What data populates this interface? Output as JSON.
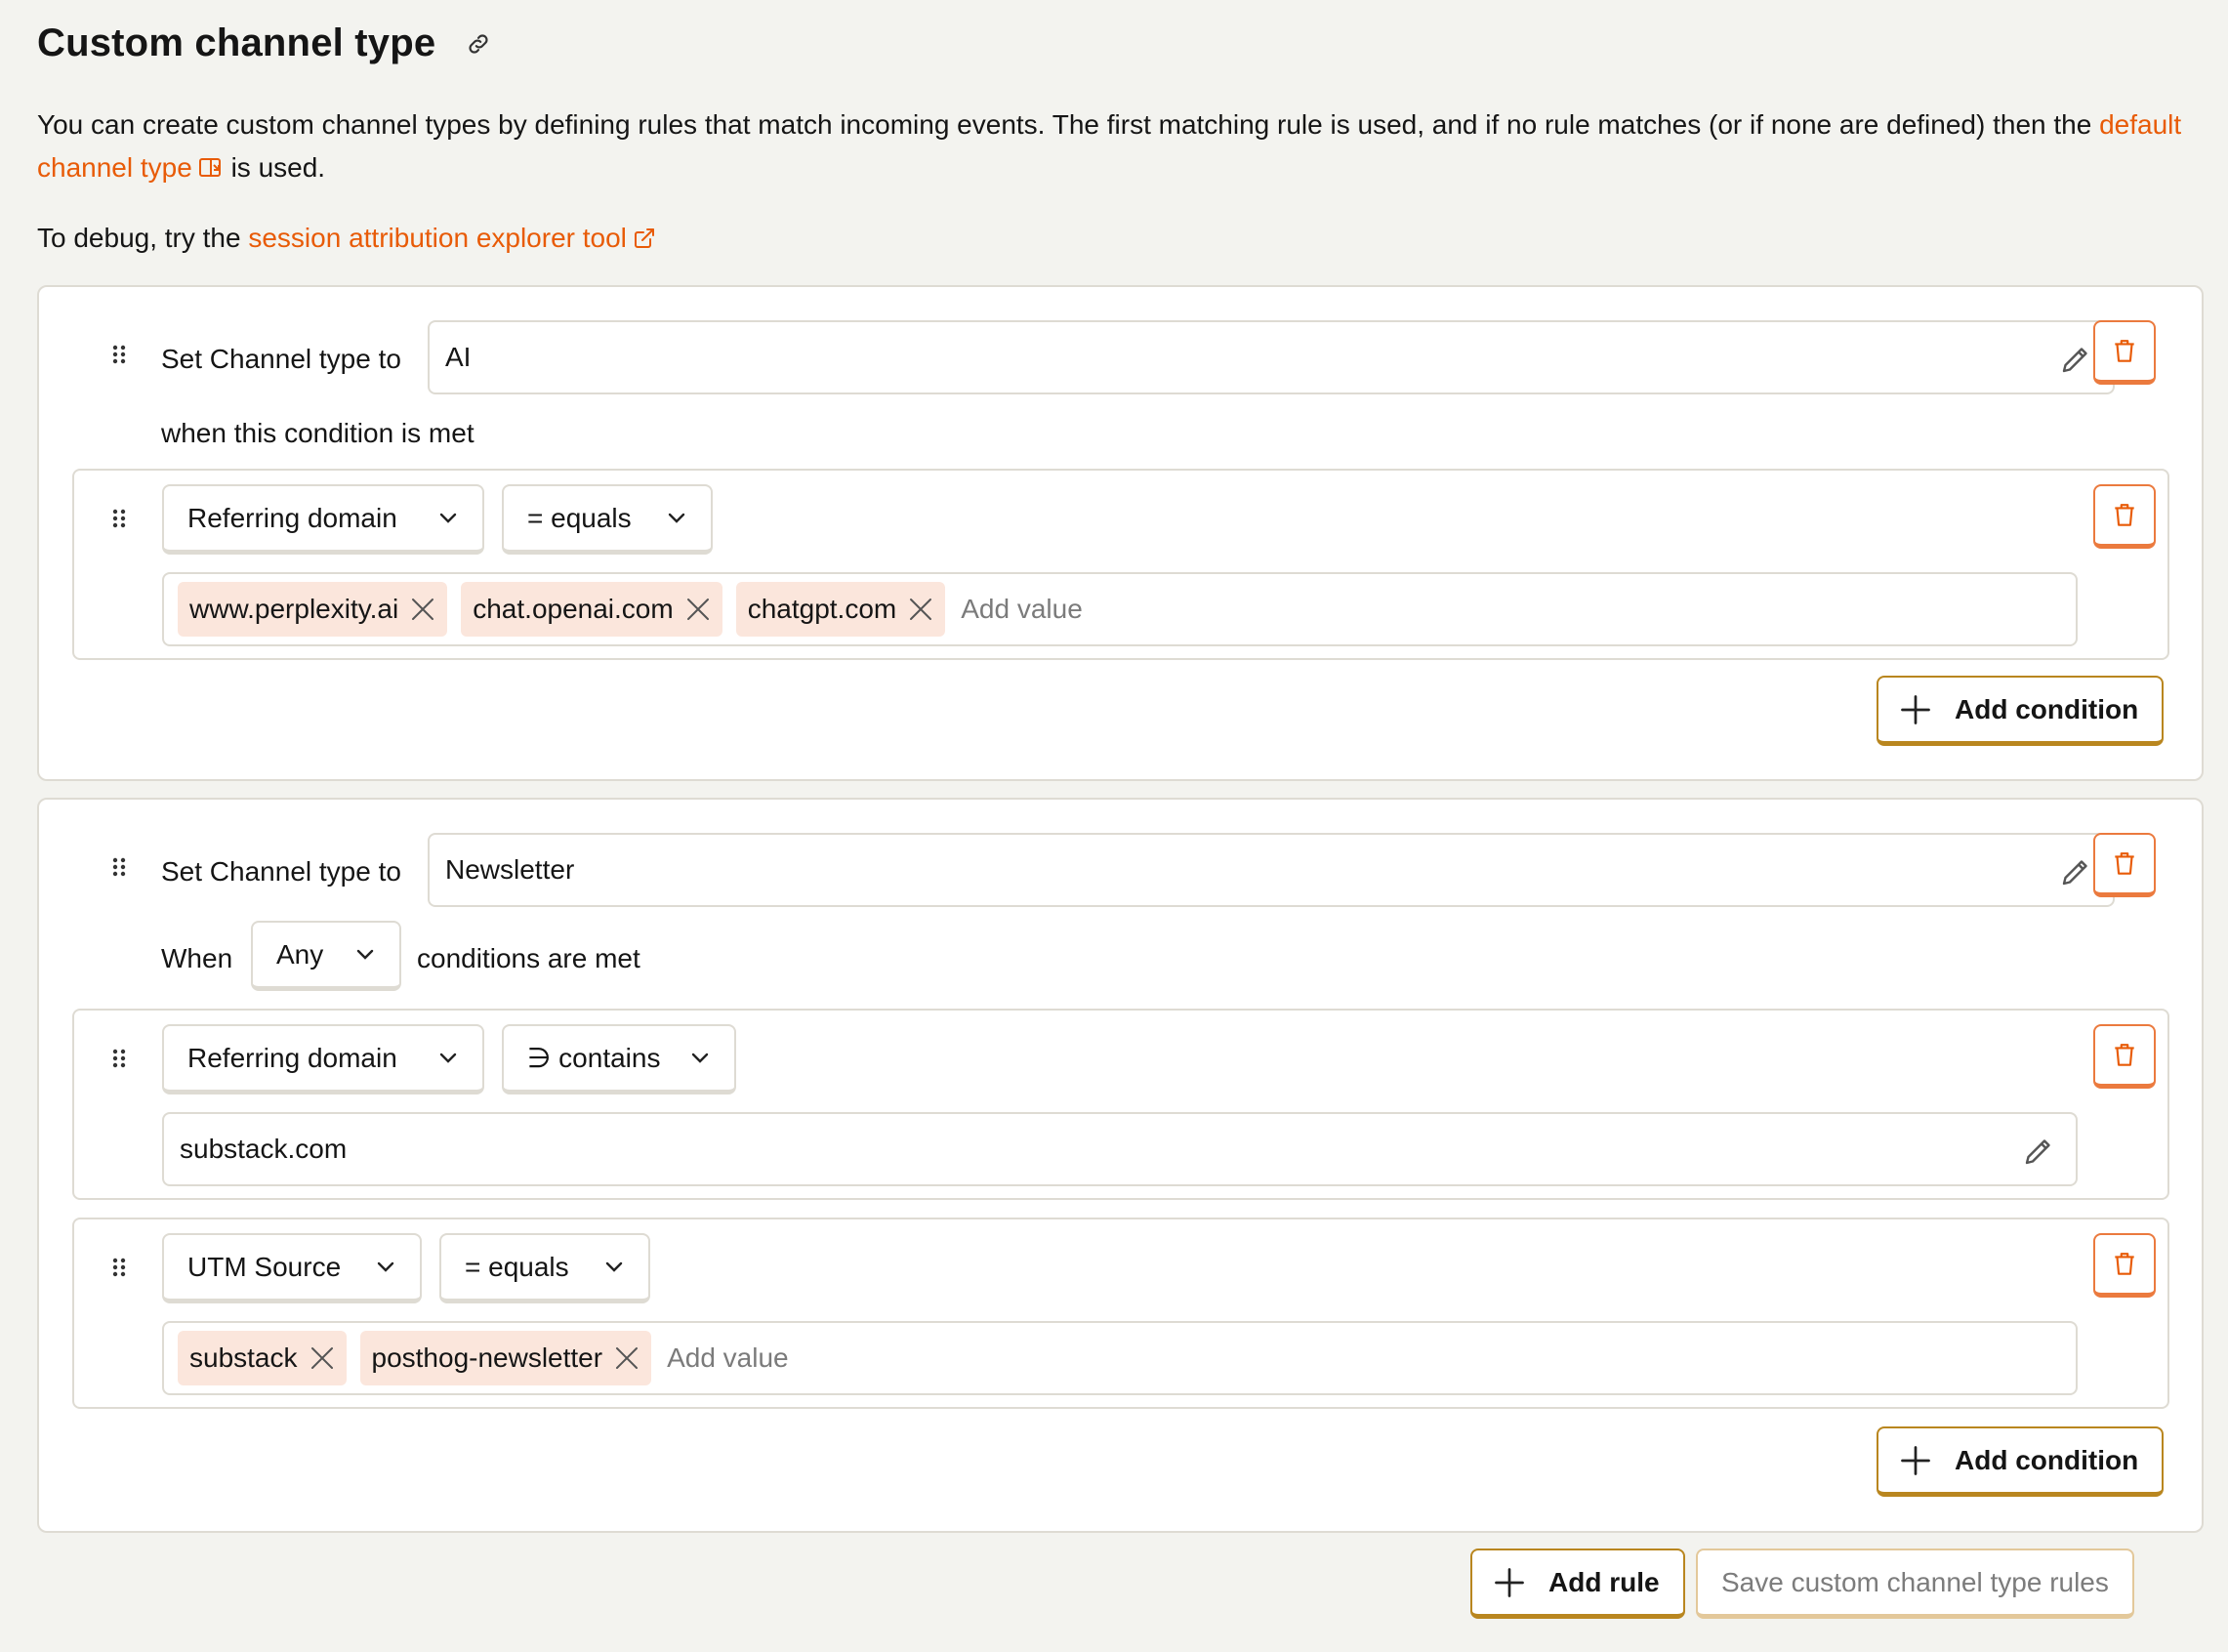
{
  "header": {
    "title": "Custom channel type"
  },
  "description": {
    "text_before_link": "You can create custom channel types by defining rules that match incoming events. The first matching rule is used, and if no rule matches (or if none are defined) then the ",
    "link_text": "default channel type",
    "text_after_link": " is used."
  },
  "debug": {
    "text_before_link": "To debug, try the ",
    "link_text": "session attribution explorer tool"
  },
  "rules": [
    {
      "set_label": "Set Channel type to",
      "channel_type": "AI",
      "condition_label": "when this condition is met",
      "conditions": [
        {
          "property": "Referring domain",
          "operator": "= equals",
          "values": [
            "www.perplexity.ai",
            "chat.openai.com",
            "chatgpt.com"
          ],
          "add_value_placeholder": "Add value"
        }
      ],
      "add_condition_label": "Add condition"
    },
    {
      "set_label": "Set Channel type to",
      "channel_type": "Newsletter",
      "when_label": "When",
      "match_mode": "Any",
      "conditions_met_label": "conditions are met",
      "conditions": [
        {
          "property": "Referring domain",
          "operator": "∋ contains",
          "value": "substack.com"
        },
        {
          "property": "UTM Source",
          "operator": "= equals",
          "values": [
            "substack",
            "posthog-newsletter"
          ],
          "add_value_placeholder": "Add value"
        }
      ],
      "add_condition_label": "Add condition"
    }
  ],
  "footer": {
    "add_rule_label": "Add rule",
    "save_label": "Save custom channel type rules"
  },
  "colors": {
    "accent_link": "#e85b07",
    "danger_border": "#eb7a3e",
    "primary_border": "#b9861f",
    "chip_bg": "#fbe6dc"
  }
}
